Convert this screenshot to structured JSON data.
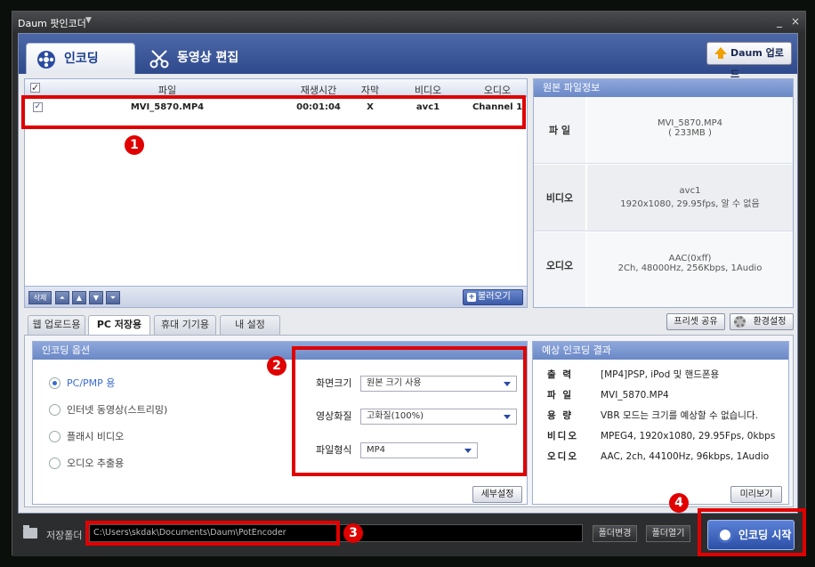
{
  "window": {
    "title": "Daum 팟인코더",
    "title_dropdown": "▼",
    "min": "_",
    "close": "×"
  },
  "main_tabs": [
    {
      "label": "인코딩"
    },
    {
      "label": "동영상 편집"
    }
  ],
  "upload_button": "Daum 업로드",
  "file_list": {
    "columns": [
      "파일",
      "재생시간",
      "자막",
      "비디오",
      "오디오"
    ],
    "rows": [
      {
        "file": "MVI_5870.MP4",
        "duration": "00:01:04",
        "subtitle": "X",
        "video": "avc1",
        "audio": "Channel 1"
      }
    ],
    "footer": {
      "delete": "삭제",
      "load": "불러오기"
    }
  },
  "source_info": {
    "title": "원본 파일정보",
    "file_label": "파 일",
    "file_name": "MVI_5870.MP4",
    "file_size": "( 233MB )",
    "video_label": "비디오",
    "video_codec": "avc1",
    "video_detail": "1920x1080, 29.95fps, 알 수 없음",
    "audio_label": "오디오",
    "audio_codec": "AAC(0xff)",
    "audio_detail": "2Ch, 48000Hz, 256Kbps, 1Audio"
  },
  "sub_tabs": [
    "웹 업로드용",
    "PC 저장용",
    "휴대 기기용",
    "내 설정"
  ],
  "preset_share": "프리셋 공유",
  "env_settings": "환경설정",
  "encoding_options": {
    "title": "인코딩 옵션",
    "radios": [
      "PC/PMP 용",
      "인터넷 동영상(스트리밍)",
      "플래시 비디오",
      "오디오 추출용"
    ],
    "settings": [
      {
        "label": "화면크기",
        "value": "원본 크기 사용"
      },
      {
        "label": "영상화질",
        "value": "고화질(100%)"
      },
      {
        "label": "파일형식",
        "value": "MP4"
      }
    ],
    "detail_button": "세부설정"
  },
  "expected_result": {
    "title": "예상 인코딩 결과",
    "rows": [
      {
        "k": "출 력",
        "v": "[MP4]PSP, iPod 및 핸드폰용"
      },
      {
        "k": "파 일",
        "v": "MVI_5870.MP4"
      },
      {
        "k": "용 량",
        "v": "VBR 모드는 크기를 예상할 수 없습니다."
      },
      {
        "k": "비디오",
        "v": "MPEG4, 1920x1080, 29.95Fps, 0kbps"
      },
      {
        "k": "오디오",
        "v": "AAC, 2ch, 44100Hz, 96kbps, 1Audio"
      }
    ],
    "preview_button": "미리보기"
  },
  "bottom": {
    "save_label": "저장폴더",
    "path": "C:\\Users\\skdak\\Documents\\Daum\\PotEncoder",
    "change_folder": "폴더변경",
    "open_folder": "폴더열기",
    "start": "인코딩 시작"
  },
  "badges": [
    "1",
    "2",
    "3",
    "4"
  ]
}
